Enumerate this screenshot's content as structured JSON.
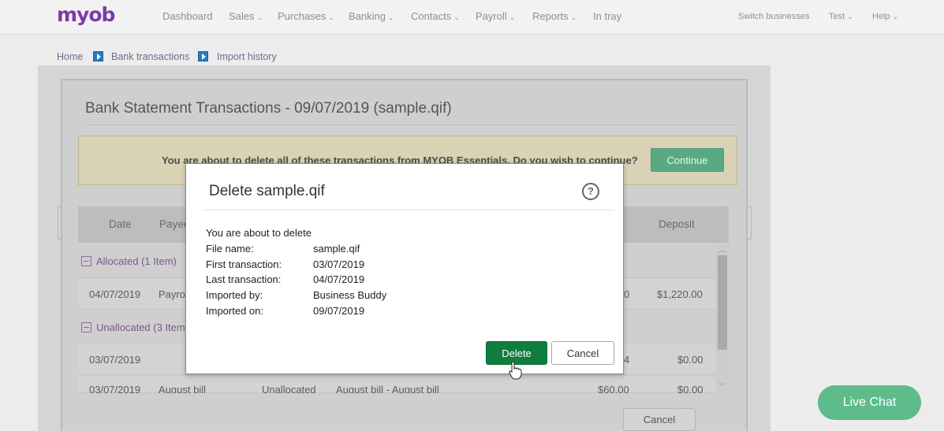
{
  "brand": {
    "logo": "myob",
    "accent": "#7a3aa8"
  },
  "nav": {
    "dashboard": "Dashboard",
    "sales": "Sales",
    "purchases": "Purchases",
    "banking": "Banking",
    "contacts": "Contacts",
    "payroll": "Payroll",
    "reports": "Reports",
    "intray": "In tray",
    "switch": "Switch businesses",
    "user": "Test",
    "help": "Help"
  },
  "breadcrumb": {
    "home": "Home",
    "bank": "Bank transactions",
    "import": "Import history"
  },
  "statement": {
    "title": "Bank Statement Transactions - 09/07/2019 (sample.qif)",
    "warning": "You are about to delete all of these transactions from MYOB Essentials. Do you wish to continue?",
    "continue_label": "Continue",
    "cancel_label": "Cancel",
    "headers": {
      "date": "Date",
      "payee": "Payee",
      "deposit": "Deposit"
    },
    "groups": {
      "allocated": "Allocated (1 Item)",
      "unallocated": "Unallocated (3 Items)"
    },
    "rows": [
      {
        "date": "04/07/2019",
        "payee": "Payroll",
        "frag": "0",
        "deposit": "$1,220.00"
      },
      {
        "date": "03/07/2019",
        "payee": "",
        "frag": "4",
        "deposit": "$0.00"
      },
      {
        "date": "03/07/2019",
        "payee": "August bill",
        "status": "Unallocated",
        "desc": "August bill - August bill",
        "amount": "$60.00",
        "deposit": "$0.00"
      }
    ]
  },
  "dialog": {
    "title": "Delete sample.qif",
    "intro": "You are about to delete",
    "file_label": "File name:",
    "file_value": "sample.qif",
    "first_label": "First transaction:",
    "first_value": "03/07/2019",
    "last_label": "Last transaction:",
    "last_value": "04/07/2019",
    "by_label": "Imported by:",
    "by_value": "Business Buddy",
    "on_label": "Imported on:",
    "on_value": "09/07/2019",
    "delete_label": "Delete",
    "cancel_label": "Cancel"
  },
  "livechat": {
    "label": "Live Chat"
  }
}
